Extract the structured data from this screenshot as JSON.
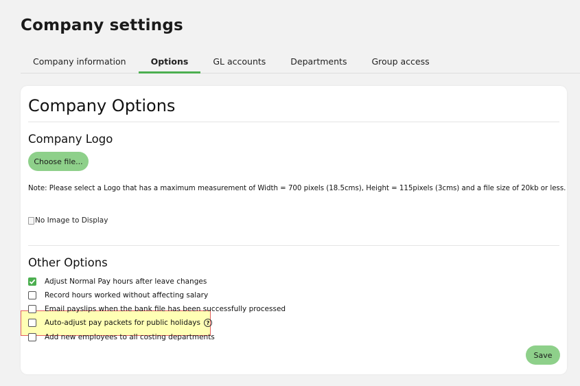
{
  "page": {
    "title": "Company settings"
  },
  "tabs": [
    {
      "label": "Company information"
    },
    {
      "label": "Options",
      "active": true
    },
    {
      "label": "GL accounts"
    },
    {
      "label": "Departments"
    },
    {
      "label": "Group access"
    }
  ],
  "card": {
    "title": "Company Options",
    "logo_section": {
      "title": "Company Logo",
      "choose_label": "Choose file...",
      "note": "Note: Please select a Logo that has a maximum measurement of Width = 700 pixels (18.5cms), Height = 115pixels (3cms) and a file size of 20kb or less.",
      "no_image_alt": "No Image to Display"
    },
    "other_section": {
      "title": "Other Options",
      "options": [
        {
          "label": "Adjust Normal Pay hours after leave changes",
          "checked": true
        },
        {
          "label": "Record hours worked without affecting salary",
          "checked": false
        },
        {
          "label": "Email payslips when the bank file has been successfully processed",
          "checked": false
        },
        {
          "label": "Auto-adjust pay packets for public holidays",
          "checked": false,
          "help_icon": "question-circle-icon"
        },
        {
          "label": "Add new employees to all costing departments",
          "checked": false
        }
      ]
    },
    "save_label": "Save"
  },
  "colors": {
    "accent": "#4caf50",
    "button": "#8ed08a",
    "highlight_border": "#e35d5d"
  }
}
